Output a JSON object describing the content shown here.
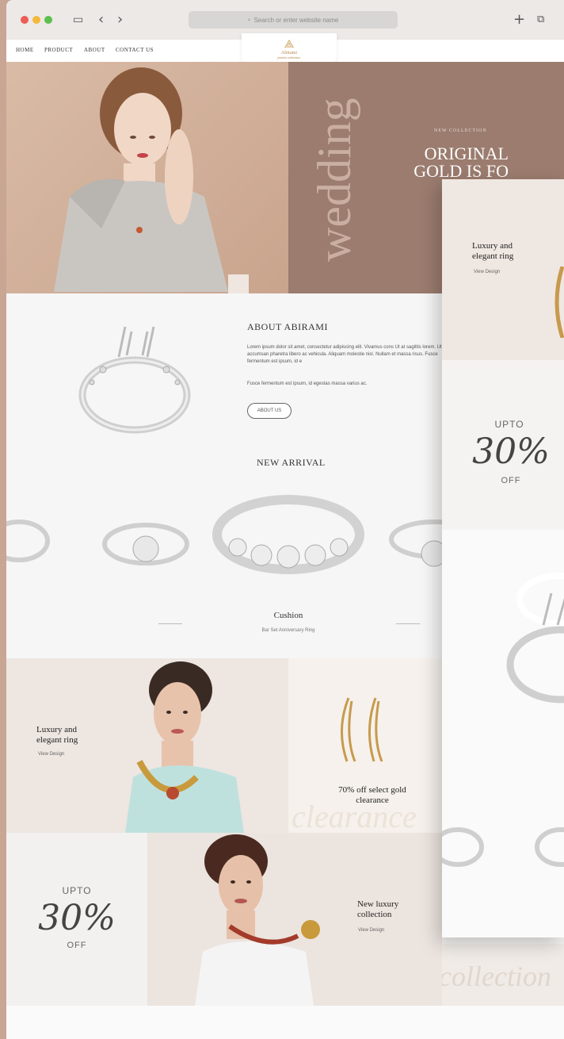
{
  "browser": {
    "search_placeholder": "Search or enter website name",
    "icons": [
      "sidebar-icon",
      "back-icon",
      "forward-icon",
      "new-tab-icon",
      "tabs-icon",
      "search-icon"
    ]
  },
  "nav": {
    "items": [
      "HOME",
      "PRODUCT",
      "ABOUT",
      "CONTACT US"
    ]
  },
  "brand": {
    "name": "Abirami",
    "tagline": "jewels collection"
  },
  "hero": {
    "vertical_word": "wedding",
    "kicker": "NEW COLLECTION",
    "headline": "ORIGINAL GOLD IS FO"
  },
  "about": {
    "title": "ABOUT ABIRAMI",
    "para1": "Lorem ipsum dolor sit amet, consectetur adipiscing elit. Vivamus cons Ut at sagittis lorem. Ut accumsan pharetra libero ac vehicula. Aliquam molestie nisl. Nullam et massa risus. Fusce fermentum est ipsum, id e",
    "para2": "Fusce fermentum est ipsum, id egestas massa varius ac.",
    "button": "ABOUT US"
  },
  "arrival": {
    "title": "NEW ARRIVAL",
    "product_name": "Cushion",
    "product_sub": "Bar Set Anniversary Ring"
  },
  "promos": {
    "tile1_title": "Luxury and elegant ring",
    "tile1_link": "View Design",
    "tile2_title": "70% off select gold clearance",
    "tile2_bg_word": "clearance",
    "sale_upto": "UPTO",
    "sale_pct": "30%",
    "sale_off": "OFF",
    "tile3_title": "New luxury collection",
    "tile3_link": "View Design",
    "tile3_bg_word": "collection"
  },
  "side_panel": {
    "title": "Luxury and elegant ring",
    "link": "View Design",
    "sale_upto": "UPTO",
    "sale_pct": "30%",
    "sale_off": "OFF"
  },
  "colors": {
    "hero_left": "#d9bba6",
    "hero_right": "#9b7c6f",
    "gold": "#c79a4d",
    "page_bg": "#c9a594"
  }
}
